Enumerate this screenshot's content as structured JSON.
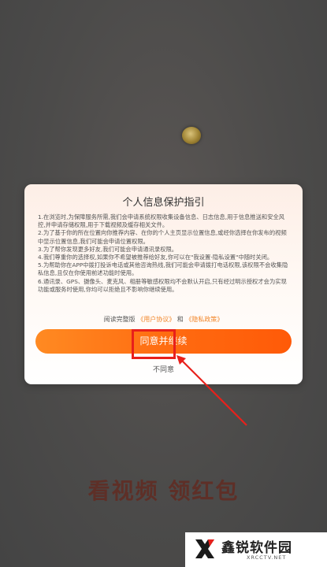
{
  "background": {
    "slogan": "看视频 领红包"
  },
  "dialog": {
    "title": "个人信息保护指引",
    "terms": [
      "1.在浏览时,为保障服务所需,我们会申请系统权限收集设备信息、日志信息,用于信息推送和安全风控,并申请存储权限,用于下载视频及缓存相关文件。",
      "2.为了基于你的所在位置向你推荐内容、在你的个人主页显示位置信息,或经你选择在你发布的视频中显示位置信息,我们可能会申请位置权限。",
      "3.为了帮你发现更多好友,我们可能会申请通讯录权限。",
      "4.我们尊重你的选择权,如果你不希望被推荐给好友,你可以在\"我设置-隐私设置\"中随时关闭。",
      "5.为帮助你在APP中拨打投诉电话或其他咨询热线,我们可能会申请拨打电话权限,该权限不会收集隐私信息,且仅在你使用前述功能时使用。",
      "6.通讯录、GPS、摄像头、麦克风、相册等敏感权限均不会默认开启,只有经过明示授权才会为实现功能或服务时使用,你均可以拒绝且不影响你继续使用。"
    ],
    "read_prefix": "阅读完整版",
    "user_agreement": "《用户协议》",
    "and": "和",
    "privacy_policy": "《隐私政策》",
    "agree_label": "同意并继续",
    "disagree_label": "不同意"
  },
  "watermark": {
    "title": "鑫锐软件园",
    "sub": "XRCCTV.NET"
  },
  "colors": {
    "accent": "#ff6a10",
    "link": "#f2862a",
    "highlight": "#e8201b"
  }
}
